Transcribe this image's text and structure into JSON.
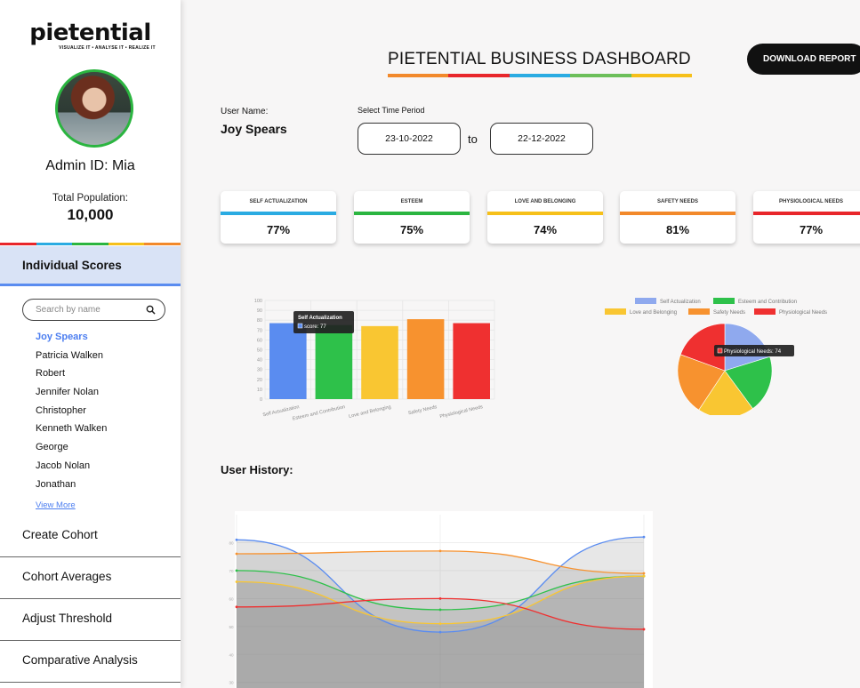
{
  "sidebar": {
    "logo_text": "pietential",
    "logo_tagline": "VISUALIZE IT • ANALYSE IT • REALIZE IT",
    "admin_label": "Admin ID: Mia",
    "population_label": "Total Population:",
    "population_value": "10,000",
    "individual_scores": "Individual Scores",
    "search_placeholder": "Search by name",
    "users": [
      "Joy Spears",
      "Patricia Walken",
      "Robert",
      "Jennifer Nolan",
      "Christopher",
      "Kenneth Walken",
      "George",
      "Jacob Nolan",
      "Jonathan"
    ],
    "view_more": "View More",
    "menu": [
      "Create Cohort",
      "Cohort Averages",
      "Adjust Threshold",
      "Comparative Analysis"
    ]
  },
  "header": {
    "title": "PIETENTIAL BUSINESS DASHBOARD",
    "download_button": "DOWNLOAD REPORT"
  },
  "user": {
    "name_label": "User Name:",
    "name": "Joy Spears",
    "period_label": "Select Time Period",
    "date_from": "23-10-2022",
    "to_label": "to",
    "date_to": "22-12-2022"
  },
  "colors": {
    "blue": "#2aabe2",
    "green": "#2bb540",
    "yellow": "#f6c01a",
    "orange": "#f2892b",
    "red": "#e8262b",
    "chart_blue": "#5a8cf0",
    "chart_green": "#2ec14a",
    "chart_yellow": "#f9c632",
    "chart_orange": "#f7922f",
    "chart_red": "#ef3030"
  },
  "score_cards": [
    {
      "name": "SELF ACTUALIZATION",
      "value": "77%",
      "color": "#2aabe2"
    },
    {
      "name": "ESTEEM",
      "value": "75%",
      "color": "#2bb540"
    },
    {
      "name": "LOVE AND BELONGING",
      "value": "74%",
      "color": "#f6c01a"
    },
    {
      "name": "SAFETY NEEDS",
      "value": "81%",
      "color": "#f2892b"
    },
    {
      "name": "PHYSIOLOGICAL NEEDS",
      "value": "77%",
      "color": "#e8262b"
    }
  ],
  "history_title": "User History:",
  "chart_data": [
    {
      "type": "bar",
      "categories": [
        "Self Actualization",
        "Esteem and Contribution",
        "Love and Belonging",
        "Safety Needs",
        "Physiological Needs"
      ],
      "values": [
        77,
        75,
        74,
        81,
        77
      ],
      "colors": [
        "#5a8cf0",
        "#2ec14a",
        "#f9c632",
        "#f7922f",
        "#ef3030"
      ],
      "ylim": [
        0,
        100
      ],
      "yticks": [
        0,
        10,
        20,
        30,
        40,
        50,
        60,
        70,
        80,
        90,
        100
      ],
      "tooltip": {
        "title": "Self Actualization",
        "label": "score: 77"
      }
    },
    {
      "type": "pie",
      "labels": [
        "Self Actualization",
        "Esteem and Contribution",
        "Love and Belonging",
        "Safety Needs",
        "Physiological Needs"
      ],
      "values": [
        77,
        75,
        74,
        81,
        74
      ],
      "colors": [
        "#8fa9ee",
        "#2ec14a",
        "#f9c632",
        "#f7922f",
        "#ef3030"
      ],
      "legend": "top",
      "tooltip": "Physiological Needs: 74"
    },
    {
      "type": "line",
      "x": [
        0,
        1,
        2
      ],
      "yticks": [
        30,
        40,
        50,
        60,
        70,
        80
      ],
      "ylim": [
        28,
        90
      ],
      "series": [
        {
          "values": [
            81,
            48,
            82
          ],
          "color": "#5a8cf0"
        },
        {
          "values": [
            76,
            77,
            69
          ],
          "color": "#f7922f"
        },
        {
          "values": [
            70,
            56,
            68
          ],
          "color": "#2ec14a"
        },
        {
          "values": [
            66,
            51,
            68
          ],
          "color": "#f9c632"
        },
        {
          "values": [
            57,
            60,
            49
          ],
          "color": "#ef3030"
        }
      ]
    }
  ]
}
